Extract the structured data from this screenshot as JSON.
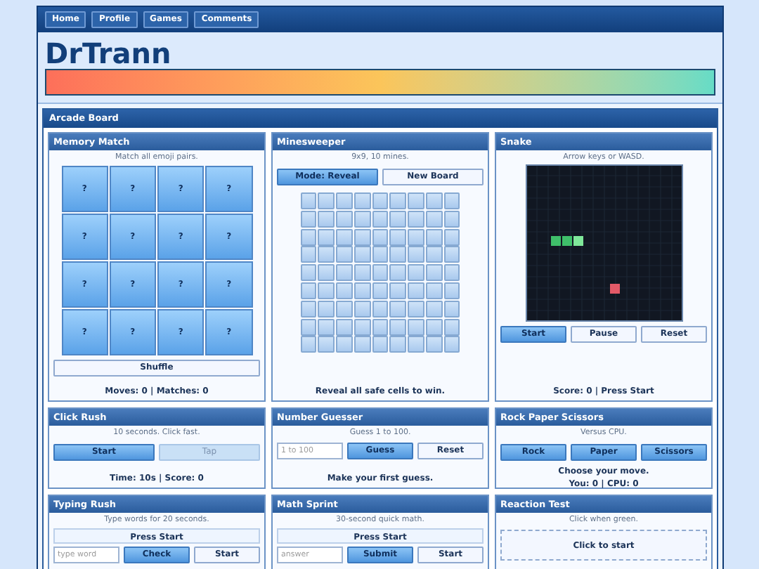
{
  "nav": [
    {
      "label": "Home"
    },
    {
      "label": "Profile"
    },
    {
      "label": "Games"
    },
    {
      "label": "Comments"
    }
  ],
  "title": "DrTrann",
  "board_title": "Arcade Board",
  "games": [
    {
      "title": "Memory Match",
      "hint": "Match all emoji pairs.",
      "body": [
        {
          "kind": "memory",
          "tiles": [
            "?",
            "?",
            "?",
            "?",
            "?",
            "?",
            "?",
            "?",
            "?",
            "?",
            "?",
            "?",
            "?",
            "?",
            "?",
            "?"
          ]
        },
        {
          "kind": "buttons",
          "buttons": [
            {
              "label": "Shuffle",
              "kind": "plain"
            }
          ]
        },
        {
          "kind": "status",
          "text": "Moves: 0 | Matches: 0"
        }
      ]
    },
    {
      "title": "Minesweeper",
      "hint": "9x9, 10 mines.",
      "body": [
        {
          "kind": "buttons",
          "buttons": [
            {
              "label": "Mode: Reveal",
              "kind": "primary"
            },
            {
              "label": "New Board",
              "kind": "plain"
            }
          ]
        },
        {
          "kind": "mines"
        },
        {
          "kind": "status",
          "text": "Reveal all safe cells to win."
        }
      ]
    },
    {
      "title": "Snake",
      "hint": "Arrow keys or WASD.",
      "body": [
        {
          "kind": "snake"
        },
        {
          "kind": "buttons",
          "buttons": [
            {
              "label": "Start",
              "kind": "primary"
            },
            {
              "label": "Pause",
              "kind": "plain"
            },
            {
              "label": "Reset",
              "kind": "plain"
            }
          ]
        },
        {
          "kind": "status",
          "text": "Score: 0 | Press Start"
        }
      ]
    },
    {
      "title": "Click Rush",
      "hint": "10 seconds. Click fast.",
      "body": [
        {
          "kind": "buttons",
          "buttons": [
            {
              "label": "Start",
              "kind": "primary"
            },
            {
              "label": "Tap",
              "kind": "disabled"
            }
          ]
        },
        {
          "kind": "status",
          "text": "Time: 10s | Score: 0"
        }
      ]
    },
    {
      "title": "Number Guesser",
      "hint": "Guess 1 to 100.",
      "body": [
        {
          "kind": "input_row",
          "placeholder": "1 to 100",
          "buttons": [
            {
              "label": "Guess",
              "kind": "primary"
            },
            {
              "label": "Reset",
              "kind": "plain"
            }
          ]
        },
        {
          "kind": "status",
          "text": "Make your first guess."
        }
      ]
    },
    {
      "title": "Rock Paper Scissors",
      "hint": "Versus CPU.",
      "body": [
        {
          "kind": "buttons",
          "buttons": [
            {
              "label": "Rock",
              "kind": "primary"
            },
            {
              "label": "Paper",
              "kind": "primary"
            },
            {
              "label": "Scissors",
              "kind": "primary"
            }
          ]
        },
        {
          "kind": "message",
          "text": "Choose your move."
        },
        {
          "kind": "status",
          "text": "You: 0 | CPU: 0"
        }
      ]
    },
    {
      "title": "Typing Rush",
      "hint": "Type words for 20 seconds.",
      "body": [
        {
          "kind": "display",
          "text": "Press Start"
        },
        {
          "kind": "input_row",
          "placeholder": "type word",
          "buttons": [
            {
              "label": "Check",
              "kind": "primary"
            },
            {
              "label": "Start",
              "kind": "plain"
            }
          ]
        }
      ]
    },
    {
      "title": "Math Sprint",
      "hint": "30-second quick math.",
      "body": [
        {
          "kind": "display",
          "text": "Press Start"
        },
        {
          "kind": "input_row",
          "placeholder": "answer",
          "buttons": [
            {
              "label": "Submit",
              "kind": "primary"
            },
            {
              "label": "Start",
              "kind": "plain"
            }
          ]
        }
      ]
    },
    {
      "title": "Reaction Test",
      "hint": "Click when green.",
      "body": [
        {
          "kind": "target",
          "text": "Click to start"
        }
      ]
    }
  ]
}
